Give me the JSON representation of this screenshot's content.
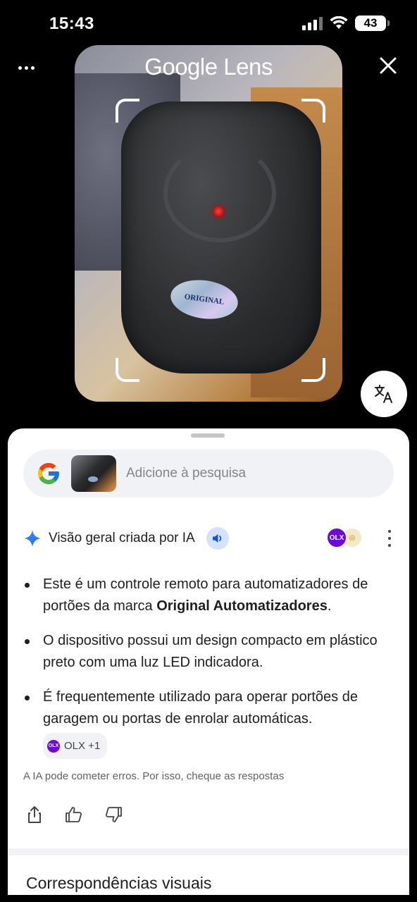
{
  "status_bar": {
    "time": "15:43",
    "battery": "43"
  },
  "header": {
    "title_google": "Google",
    "title_lens": "Lens"
  },
  "search": {
    "placeholder": "Adicione à pesquisa"
  },
  "ai_overview": {
    "title": "Visão geral criada por IA",
    "bullets": [
      {
        "text_before": "Este é um controle remoto para automatizadores de portões da marca ",
        "bold": "Original Automatizadores",
        "text_after": "."
      },
      {
        "text": "O dispositivo possui um design compacto em plástico preto com uma luz LED indicadora."
      },
      {
        "text": "É frequentemente utilizado para operar portões de garagem ou portas de enrolar automáticas."
      }
    ],
    "source_chip": "OLX +1",
    "disclaimer": "A IA pode cometer erros. Por isso, cheque as respostas"
  },
  "visual_matches": {
    "title": "Correspondências visuais"
  },
  "photo_sticker_text": "ORIGINAL",
  "colors": {
    "accent_blue": "#4285F4",
    "olx_purple": "#6e0ad6",
    "sheet_bg": "#ffffff"
  }
}
